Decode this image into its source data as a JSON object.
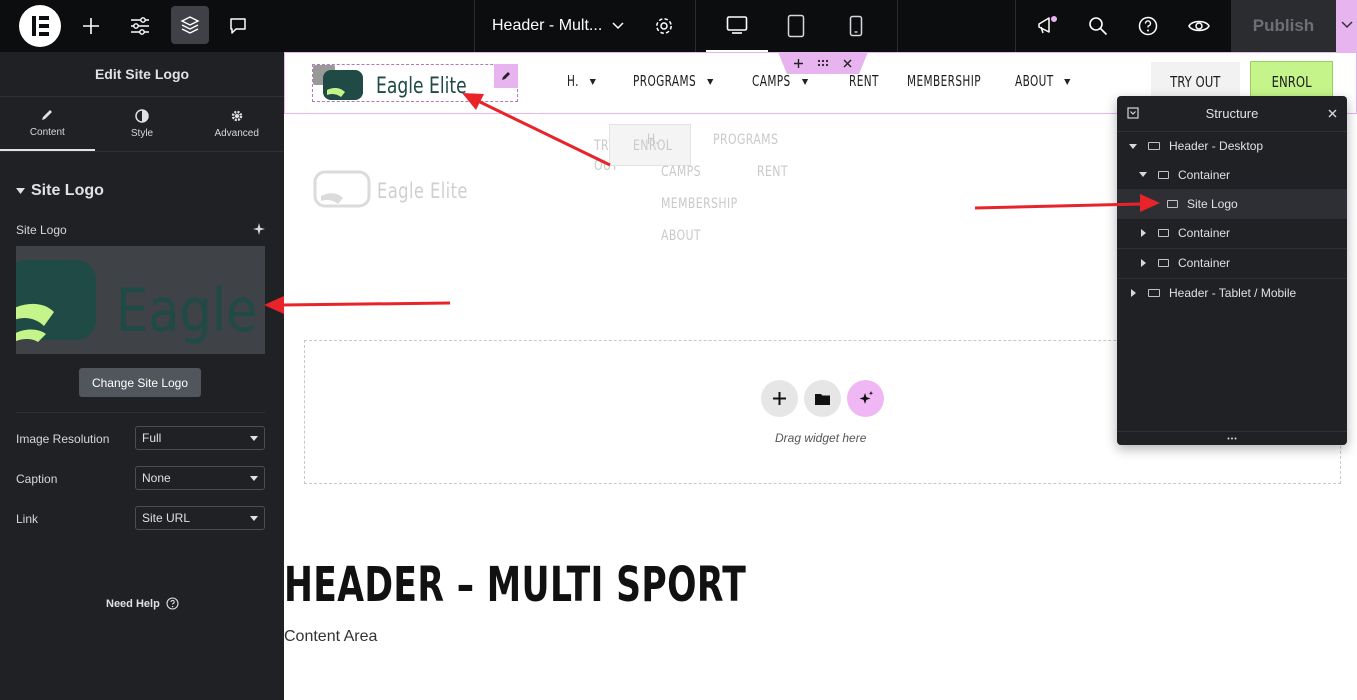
{
  "topbar": {
    "document_title": "Header - Mult...",
    "publish_label": "Publish"
  },
  "left_panel": {
    "title": "Edit Site Logo",
    "tabs": [
      {
        "label": "Content",
        "icon": "pencil-icon"
      },
      {
        "label": "Style",
        "icon": "half-circle-icon"
      },
      {
        "label": "Advanced",
        "icon": "gear-icon"
      }
    ],
    "section_title": "Site Logo",
    "site_logo_label": "Site Logo",
    "logo_preview_text": "Eagle E",
    "change_logo_button": "Change Site Logo",
    "fields": [
      {
        "label": "Image Resolution",
        "value": "Full"
      },
      {
        "label": "Caption",
        "value": "None"
      },
      {
        "label": "Link",
        "value": "Site URL"
      }
    ],
    "need_help": "Need Help"
  },
  "canvas": {
    "logo_text": "Eagle Elite",
    "nav": [
      {
        "label": "H.",
        "has_caret": true
      },
      {
        "label": "PROGRAMS",
        "has_caret": true
      },
      {
        "label": "CAMPS",
        "has_caret": true
      },
      {
        "label": "RENT",
        "has_caret": false
      },
      {
        "label": "MEMBERSHIP",
        "has_caret": false
      },
      {
        "label": "ABOUT",
        "has_caret": true
      }
    ],
    "try_out": "TRY OUT",
    "enrol": "ENROL",
    "ghost": {
      "logo_text": "Eagle Elite",
      "try": "TRY",
      "out": "OUT",
      "enrol": "ENROL",
      "h": "H.",
      "programs": "PROGRAMS",
      "camps": "CAMPS",
      "rent": "RENT",
      "membership": "MEMBERSHIP",
      "about": "ABOUT"
    },
    "drag_widget": "Drag widget here",
    "page_heading": "HEADER – MULTI SPORT",
    "content_area": "Content Area"
  },
  "structure": {
    "title": "Structure",
    "items": [
      {
        "label": "Header - Desktop",
        "expanded": true
      },
      {
        "label": "Container",
        "expanded": true
      },
      {
        "label": "Site Logo",
        "selected": true
      },
      {
        "label": "Container",
        "expanded": false
      },
      {
        "label": "Container",
        "expanded": false
      },
      {
        "label": "Header - Tablet / Mobile",
        "expanded": false
      }
    ]
  },
  "colors": {
    "topbar_bg": "#0c0d0e",
    "panel_bg": "#1f2124",
    "brand_green": "#1f4a45",
    "accent_lime": "#c5f58a",
    "accent_pink": "#e8b4f0",
    "annotation_red": "#e8242a"
  }
}
